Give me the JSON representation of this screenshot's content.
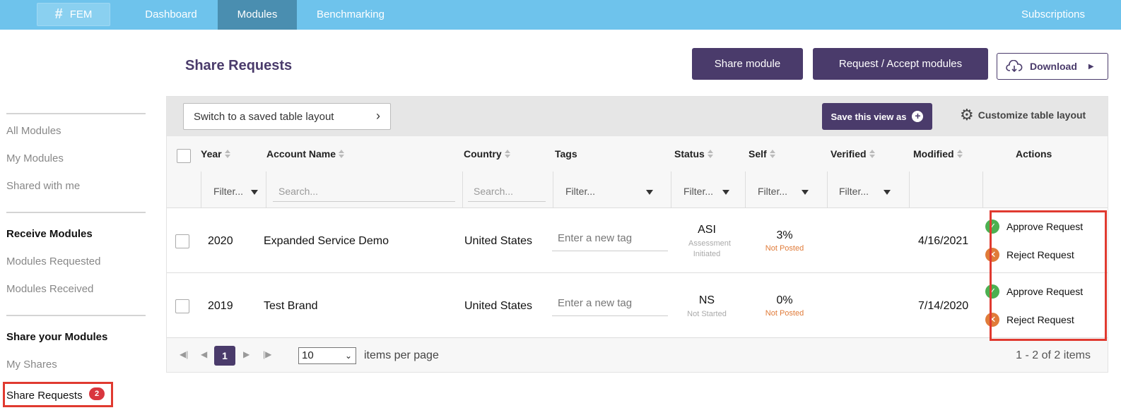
{
  "nav": {
    "brand": "FEM",
    "tabs": [
      "Dashboard",
      "Modules",
      "Benchmarking"
    ],
    "active_tab": "Modules",
    "right": "Subscriptions"
  },
  "sidebar": {
    "links_1": [
      "All Modules",
      "My Modules",
      "Shared with me"
    ],
    "heading_receive": "Receive Modules",
    "links_2": [
      "Modules Requested",
      "Modules Received"
    ],
    "heading_share": "Share your Modules",
    "links_3": [
      "My Shares",
      "Share Requests"
    ],
    "share_requests_badge": "2"
  },
  "header": {
    "title": "Share Requests",
    "share_button": "Share module",
    "request_button": "Request / Accept modules",
    "download_button": "Download"
  },
  "toolbar": {
    "saved_layout": "Switch to a saved table layout",
    "save_view": "Save this view as",
    "customize": "Customize table layout"
  },
  "columns": {
    "year": "Year",
    "account": "Account Name",
    "country": "Country",
    "tags": "Tags",
    "status": "Status",
    "self": "Self",
    "verified": "Verified",
    "modified": "Modified",
    "actions": "Actions"
  },
  "filters": {
    "filter": "Filter...",
    "search": "Search..."
  },
  "rows": [
    {
      "year": "2020",
      "account": "Expanded Service Demo",
      "country": "United States",
      "tag_placeholder": "Enter a new tag",
      "status": "ASI",
      "status_sub": "Assessment Initiated",
      "self": "3%",
      "self_sub": "Not Posted",
      "modified": "4/16/2021",
      "approve": "Approve Request",
      "reject": "Reject Request"
    },
    {
      "year": "2019",
      "account": "Test Brand",
      "country": "United States",
      "tag_placeholder": "Enter a new tag",
      "status": "NS",
      "status_sub": "Not Started",
      "self": "0%",
      "self_sub": "Not Posted",
      "modified": "7/14/2020",
      "approve": "Approve Request",
      "reject": "Reject Request"
    }
  ],
  "pager": {
    "page": "1",
    "page_size": "10",
    "items_label": "items per page",
    "summary": "1 - 2 of 2 items"
  }
}
